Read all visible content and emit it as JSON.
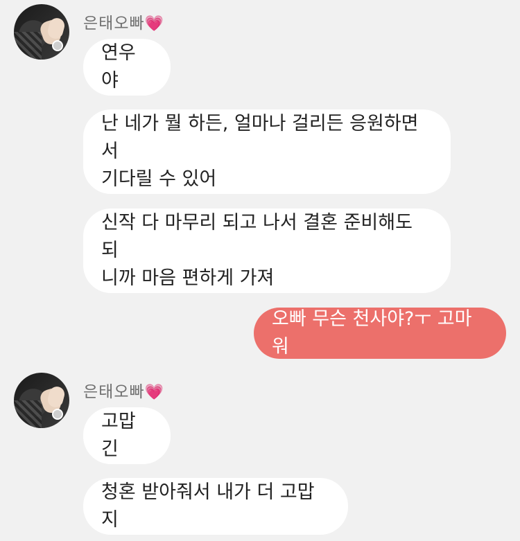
{
  "sender_name": "은태오빠",
  "heart": "💗",
  "messages": {
    "m1": "연우야",
    "m2": "난 네가 뭘 하든, 얼마나 걸리든 응원하면서\n 기다릴 수 있어",
    "m3": "신작 다 마무리 되고 나서 결혼 준비해도 되\n니까 마음 편하게 가져",
    "m4": "오빠 무슨 천사야?ㅜ 고마워",
    "m5": "고맙긴",
    "m6": "청혼 받아줘서 내가 더 고맙지"
  },
  "colors": {
    "background": "#f1f1f1",
    "bubble_received": "#ffffff",
    "bubble_sent": "#ec706b",
    "name_text": "#6f6f6f"
  }
}
